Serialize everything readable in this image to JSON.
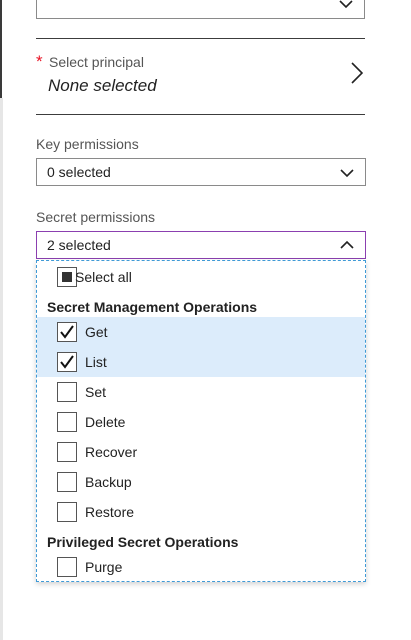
{
  "principal": {
    "required_marker": "*",
    "label": "Select principal",
    "value": "None selected"
  },
  "key_permissions": {
    "label": "Key permissions",
    "value": "0 selected"
  },
  "secret_permissions": {
    "label": "Secret permissions",
    "value": "2 selected",
    "dropdown": {
      "select_all_label": "Select all",
      "groups": [
        {
          "title": "Secret Management Operations",
          "items": [
            {
              "label": "Get",
              "checked": true
            },
            {
              "label": "List",
              "checked": true
            },
            {
              "label": "Set",
              "checked": false
            },
            {
              "label": "Delete",
              "checked": false
            },
            {
              "label": "Recover",
              "checked": false
            },
            {
              "label": "Backup",
              "checked": false
            },
            {
              "label": "Restore",
              "checked": false
            }
          ]
        },
        {
          "title": "Privileged Secret Operations",
          "items": [
            {
              "label": "Purge",
              "checked": false
            }
          ]
        }
      ]
    }
  },
  "colors": {
    "required": "#e81123",
    "selected_row": "#dcecfb",
    "focus_border": "#8b3fb0",
    "dropdown_border": "#3f9ad6"
  },
  "icons": [
    "chevron-down-icon",
    "chevron-right-icon",
    "chevron-up-icon",
    "checkmark-icon"
  ]
}
